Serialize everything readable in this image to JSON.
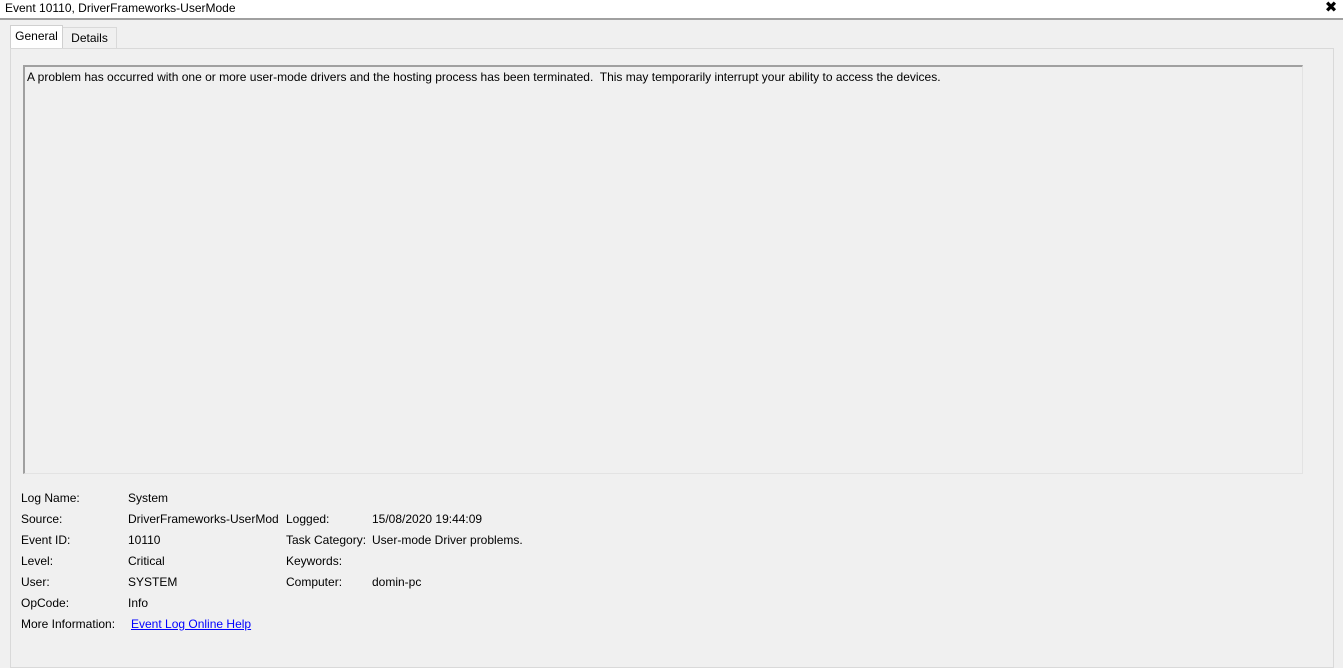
{
  "window": {
    "title": "Event 10110, DriverFrameworks-UserMode",
    "close_glyph": "✖"
  },
  "tabs": [
    {
      "label": "General",
      "selected": true
    },
    {
      "label": "Details",
      "selected": false
    }
  ],
  "description": "A problem has occurred with one or more user-mode drivers and the hosting process has been terminated.  This may temporarily interrupt your ability to access the devices.",
  "fields": {
    "log_name": {
      "label": "Log Name:",
      "value": "System"
    },
    "source": {
      "label": "Source:",
      "value": "DriverFrameworks-UserMod"
    },
    "logged": {
      "label": "Logged:",
      "value": "15/08/2020 19:44:09"
    },
    "event_id": {
      "label": "Event ID:",
      "value": "10110"
    },
    "task_category": {
      "label": "Task Category:",
      "value": "User-mode Driver problems."
    },
    "level": {
      "label": "Level:",
      "value": "Critical"
    },
    "keywords": {
      "label": "Keywords:",
      "value": ""
    },
    "user": {
      "label": "User:",
      "value": "SYSTEM"
    },
    "computer": {
      "label": "Computer:",
      "value": "domin-pc"
    },
    "opcode": {
      "label": "OpCode:",
      "value": "Info"
    },
    "more_info": {
      "label": "More Information:",
      "link": "Event Log Online Help"
    }
  },
  "colors": {
    "background": "#f0f0f0",
    "link": "#0000ff"
  }
}
